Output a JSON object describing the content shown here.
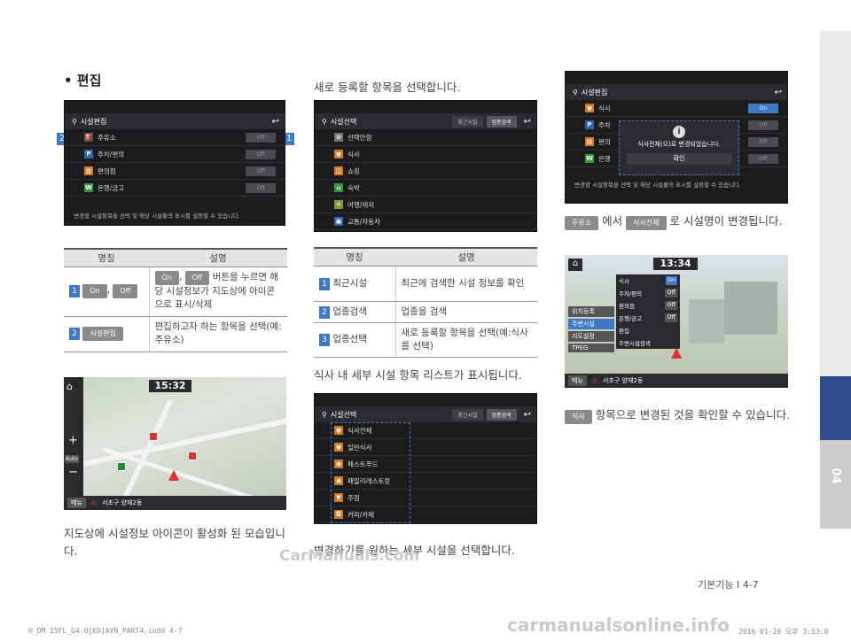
{
  "side_tab": {
    "number": "04"
  },
  "col1": {
    "heading": "• 편집",
    "screen": {
      "title": "시설편집",
      "rows": [
        "주유소",
        "주차/편의",
        "편의점",
        "은행/금고"
      ],
      "toggle": "Off",
      "footer": "변경할 시설항목을 선택 및 해당 시설물의 표시를 설정할 수 있습니다."
    },
    "table": {
      "headers": [
        "명칭",
        "설명"
      ],
      "rows": [
        {
          "num": "1",
          "chips": [
            "On",
            "Off"
          ],
          "sep": ",",
          "chip_on": "On",
          "chip_off": "Off",
          "desc_after": "버튼을 누르면 해당 시설정보가 지도상에 아이콘으로 표시/삭제"
        },
        {
          "num": "2",
          "chip": "시설편집",
          "desc": "편집하고자 하는 항목을 선택(예:주유소)"
        }
      ]
    },
    "map": {
      "time": "15:32",
      "menu": "메뉴",
      "location": "서초구 양재2동",
      "auto": "Auto"
    },
    "caption": "지도상에 시설정보 아이콘이 활성화 된 모습입니다."
  },
  "col2": {
    "intro": "새로 등록할 항목을 선택합니다.",
    "screen": {
      "title": "시설선택",
      "btn_recent": "최근시설",
      "btn_search": "업종검색",
      "rows": [
        "선택안함",
        "식사",
        "쇼핑",
        "숙박",
        "여행/레저",
        "교통/자동차"
      ]
    },
    "table": {
      "headers": [
        "명칭",
        "설명"
      ],
      "rows": [
        {
          "num": "1",
          "name": "최근시설",
          "desc": "최근에 검색한 시설 정보를 확인"
        },
        {
          "num": "2",
          "name": "업종검색",
          "desc": "업종을 검색"
        },
        {
          "num": "3",
          "name": "업종선택",
          "desc": "새로 등록할 항목을 선택(예:식사를 선택)"
        }
      ]
    },
    "mid_text": "식사 내 세부 시설 항목 리스트가 표시됩니다.",
    "screen2": {
      "title": "시설선택",
      "btn_recent": "최근시설",
      "btn_search": "업종검색",
      "rows": [
        "식사전체",
        "일반식사",
        "패스트푸드",
        "패밀리레스토랑",
        "주점",
        "커피/카페"
      ]
    },
    "caption": "변경하기를 원하는 세부 시설을 선택합니다."
  },
  "col3": {
    "screen": {
      "title": "시설편집",
      "rows": [
        "식사",
        "주차",
        "편의",
        "은행"
      ],
      "toggle_on": "On",
      "toggle": "Off",
      "popup_text": "식사전체(으)로 변경되었습니다.",
      "popup_btn": "확인",
      "footer": "변경할 시설항목을 선택 및 해당 시설물의 표시를 설정할 수 있습니다."
    },
    "text1_chip1": "주유소",
    "text1_mid": "에서",
    "text1_chip2": "식사전체",
    "text1_end": "로 시설명이 변경됩니다.",
    "map": {
      "time": "13:34",
      "menu_items": [
        "위치등록",
        "주변시설",
        "지도설정",
        "TPEG"
      ],
      "panel_items": [
        "식사",
        "주차/편의",
        "편의점",
        "은행/금고",
        "편집",
        "주변시설검색"
      ],
      "on": "On",
      "off": "Off",
      "menu": "메뉴",
      "location": "서초구 양재2동"
    },
    "text2_chip": "식사",
    "text2": "항목으로 변경된 것을 확인할 수 있습니다."
  },
  "page_number": "기본기능 I 4-7",
  "footer_left": "H_DM 15FL_G4.0[KO]AVN_PART4.indd   4-7",
  "footer_right": "2016-01-29   오후 3:53:0",
  "watermark1": "CarManuals.com",
  "watermark2": "carmanualsonline.info"
}
